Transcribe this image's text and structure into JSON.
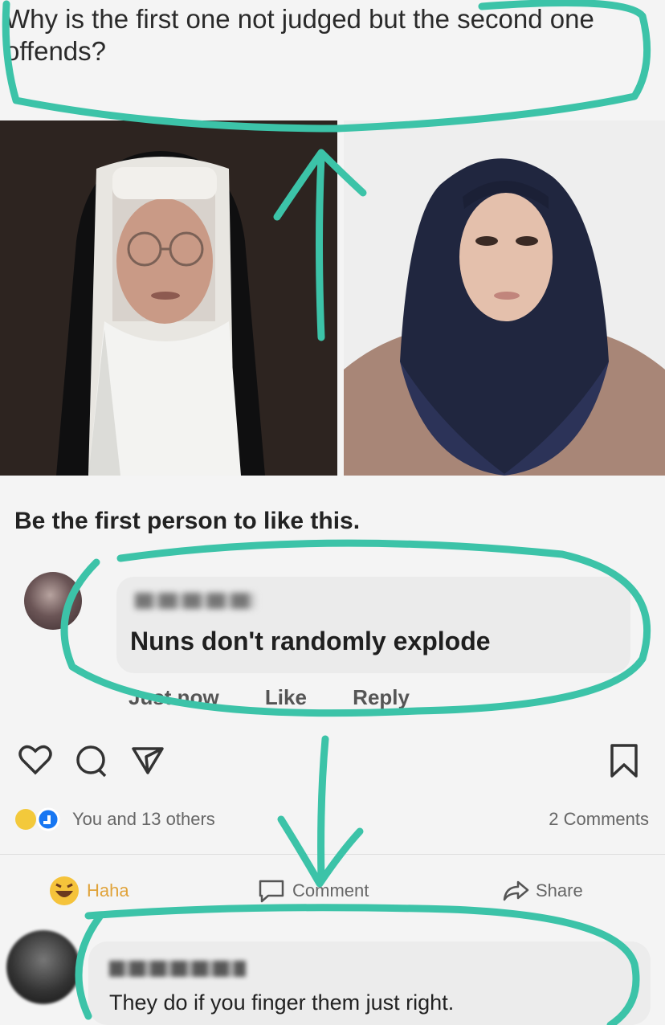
{
  "post": {
    "question": "Why is the first one not judged but the second one offends?"
  },
  "photos": {
    "left_alt": "nun",
    "right_alt": "hijab"
  },
  "likes_prompt": "Be the first person to like this.",
  "comment1": {
    "text": "Nuns don't randomly explode",
    "time": "Just now",
    "like": "Like",
    "reply": "Reply"
  },
  "reactions": {
    "summary": "You and 13 others",
    "comments_count": "2 Comments"
  },
  "action_bar": {
    "haha": "Haha",
    "comment": "Comment",
    "share": "Share"
  },
  "comment2": {
    "text": "They do if you finger them just right."
  },
  "colors": {
    "annotation": "#3cc3a8",
    "bubble": "#ebebeb"
  }
}
